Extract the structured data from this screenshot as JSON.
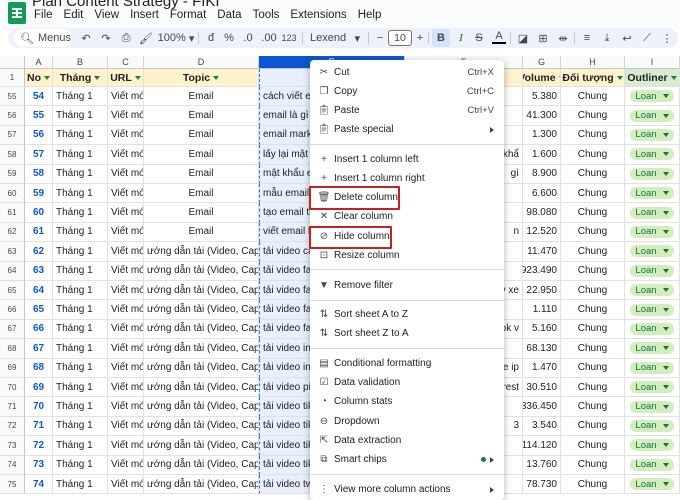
{
  "app": {
    "doc_title": "Plan Content Strategy - FIKI",
    "menu": [
      "File",
      "Edit",
      "View",
      "Insert",
      "Format",
      "Data",
      "Tools",
      "Extensions",
      "Help"
    ]
  },
  "toolbar": {
    "search_label": "Menus",
    "zoom": "100%",
    "currency": "đ",
    "percent": "%",
    "dec_decrease": ".0",
    "dec_increase": ".00",
    "number_format": "123",
    "font": "Lexend",
    "font_size": "10",
    "bold": "B",
    "italic": "I",
    "strike": "S",
    "text_color": "A"
  },
  "columns": [
    "A",
    "B",
    "C",
    "D",
    "E",
    "F",
    "G",
    "H",
    "I"
  ],
  "header_row": {
    "row_num": "1",
    "no": "No",
    "thang": "Tháng",
    "url": "URL",
    "topic": "Topic",
    "parent": "Pare",
    "volume": "Volume",
    "doi_tuong": "Đối tượng",
    "outliner": "Outliner"
  },
  "rows": [
    {
      "r": "55",
      "no": "54",
      "thang": "Tháng 1",
      "url": "Viết mới",
      "topic": "Email",
      "parent": "cách viết em",
      "f": "",
      "vol": "5.380",
      "doi": "Chung",
      "out": "Loan"
    },
    {
      "r": "56",
      "no": "55",
      "thang": "Tháng 1",
      "url": "Viết mới",
      "topic": "Email",
      "parent": "email là gì",
      "f": "",
      "vol": "41.300",
      "doi": "Chung",
      "out": "Loan"
    },
    {
      "r": "57",
      "no": "56",
      "thang": "Tháng 1",
      "url": "Viết mới",
      "topic": "Email",
      "parent": "email market",
      "f": "",
      "vol": "1.300",
      "doi": "Chung",
      "out": "Loan"
    },
    {
      "r": "58",
      "no": "57",
      "thang": "Tháng 1",
      "url": "Viết mới",
      "topic": "Email",
      "parent": "lấy lại mật k",
      "f": "uất khẩ",
      "vol": "1.600",
      "doi": "Chung",
      "out": "Loan"
    },
    {
      "r": "59",
      "no": "58",
      "thang": "Tháng 1",
      "url": "Viết mới",
      "topic": "Email",
      "parent": "mật khẩu em",
      "f": "gì",
      "vol": "8.900",
      "doi": "Chung",
      "out": "Loan"
    },
    {
      "r": "60",
      "no": "59",
      "thang": "Tháng 1",
      "url": "Viết mới",
      "topic": "Email",
      "parent": "mẫu email tỉ",
      "f": "",
      "vol": "6.600",
      "doi": "Chung",
      "out": "Loan"
    },
    {
      "r": "61",
      "no": "60",
      "thang": "Tháng 1",
      "url": "Viết mới",
      "topic": "Email",
      "parent": "tạo email tr",
      "f": "",
      "vol": "98.080",
      "doi": "Chung",
      "out": "Loan"
    },
    {
      "r": "62",
      "no": "61",
      "thang": "Tháng 1",
      "url": "Viết mới",
      "topic": "Email",
      "parent": "viết email b",
      "f": "n",
      "vol": "12.520",
      "doi": "Chung",
      "out": "Loan"
    },
    {
      "r": "63",
      "no": "62",
      "thang": "Tháng 1",
      "url": "Viết mới",
      "topic": "ướng dẫn tải (Video, Capcut,",
      "parent": "tải video ca",
      "f": "",
      "vol": "11.470",
      "doi": "Chung",
      "out": "Loan"
    },
    {
      "r": "64",
      "no": "63",
      "thang": "Tháng 1",
      "url": "Viết mới",
      "topic": "ướng dẫn tải (Video, Capcut,",
      "parent": "tải video fac",
      "f": "",
      "vol": "923.490",
      "doi": "Chung",
      "out": "Loan"
    },
    {
      "r": "65",
      "no": "64",
      "thang": "Tháng 1",
      "url": "Viết mới",
      "topic": "ướng dẫn tải (Video, Capcut,",
      "parent": "tải video fac",
      "f": "tv xe",
      "vol": "22.950",
      "doi": "Chung",
      "out": "Loan"
    },
    {
      "r": "66",
      "no": "65",
      "thang": "Tháng 1",
      "url": "Viết mới",
      "topic": "ướng dẫn tải (Video, Capcut,",
      "parent": "tải video fac",
      "f": "",
      "vol": "1.110",
      "doi": "Chung",
      "out": "Loan"
    },
    {
      "r": "67",
      "no": "66",
      "thang": "Tháng 1",
      "url": "Viết mới",
      "topic": "ướng dẫn tải (Video, Capcut,",
      "parent": "tải video fac",
      "f": "ook v",
      "vol": "5.160",
      "doi": "Chung",
      "out": "Loan"
    },
    {
      "r": "68",
      "no": "67",
      "thang": "Tháng 1",
      "url": "Viết mới",
      "topic": "ướng dẫn tải (Video, Capcut,",
      "parent": "tải video ins",
      "f": "",
      "vol": "68.130",
      "doi": "Chung",
      "out": "Loan"
    },
    {
      "r": "69",
      "no": "68",
      "thang": "Tháng 1",
      "url": "Viết mới",
      "topic": "ướng dẫn tải (Video, Capcut,",
      "parent": "tải video ins",
      "f": "ve ip",
      "vol": "1.470",
      "doi": "Chung",
      "out": "Loan"
    },
    {
      "r": "70",
      "no": "69",
      "thang": "Tháng 1",
      "url": "Viết mới",
      "topic": "ướng dẫn tải (Video, Capcut,",
      "parent": "tải video pin",
      "f": "rest",
      "vol": "30.510",
      "doi": "Chung",
      "out": "Loan"
    },
    {
      "r": "71",
      "no": "70",
      "thang": "Tháng 1",
      "url": "Viết mới",
      "topic": "ướng dẫn tải (Video, Capcut,",
      "parent": "tải video tikt",
      "f": "",
      "vol": "6.336.450",
      "doi": "Chung",
      "out": "Loan"
    },
    {
      "r": "72",
      "no": "71",
      "thang": "Tháng 1",
      "url": "Viết mới",
      "topic": "ướng dẫn tải (Video, Capcut,",
      "parent": "tải video tikt",
      "f": "3",
      "vol": "3.540",
      "doi": "Chung",
      "out": "Loan"
    },
    {
      "r": "73",
      "no": "72",
      "thang": "Tháng 1",
      "url": "Viết mới",
      "topic": "ướng dẫn tải (Video, Capcut,",
      "parent": "tải video tikt",
      "f": "",
      "vol": "114.120",
      "doi": "Chung",
      "out": "Loan"
    },
    {
      "r": "74",
      "no": "73",
      "thang": "Tháng 1",
      "url": "Viết mới",
      "topic": "ướng dẫn tải (Video, Capcut,",
      "parent": "tải video tikt",
      "f": "",
      "vol": "13.760",
      "doi": "Chung",
      "out": "Loan"
    },
    {
      "r": "75",
      "no": "74",
      "thang": "Tháng 1",
      "url": "Viết mới",
      "topic": "ướng dẫn tải (Video, Capcut,",
      "parent": "tải video twi",
      "f": "",
      "vol": "78.730",
      "doi": "Chung",
      "out": "Loan"
    }
  ],
  "context_menu": {
    "cut": {
      "label": "Cut",
      "shortcut": "Ctrl+X"
    },
    "copy": {
      "label": "Copy",
      "shortcut": "Ctrl+C"
    },
    "paste": {
      "label": "Paste",
      "shortcut": "Ctrl+V"
    },
    "paste_special": {
      "label": "Paste special"
    },
    "insert_left": {
      "label": "Insert 1 column left"
    },
    "insert_right": {
      "label": "Insert 1 column right"
    },
    "delete_column": {
      "label": "Delete column"
    },
    "clear_column": {
      "label": "Clear column"
    },
    "hide_column": {
      "label": "Hide column"
    },
    "resize_column": {
      "label": "Resize column"
    },
    "remove_filter": {
      "label": "Remove filter"
    },
    "sort_az": {
      "label": "Sort sheet A to Z"
    },
    "sort_za": {
      "label": "Sort sheet Z to A"
    },
    "conditional": {
      "label": "Conditional formatting"
    },
    "validation": {
      "label": "Data validation"
    },
    "stats": {
      "label": "Column stats"
    },
    "dropdown": {
      "label": "Dropdown"
    },
    "extraction": {
      "label": "Data extraction"
    },
    "smart_chips": {
      "label": "Smart chips"
    },
    "more_actions": {
      "label": "View more column actions"
    }
  },
  "colors": {
    "header_yellow": "#fff2cc",
    "selected_column": "#e8f0fe",
    "chip_green": "#d4edbc",
    "highlight_red": "#c5221f",
    "accent_blue": "#0b57d0"
  }
}
